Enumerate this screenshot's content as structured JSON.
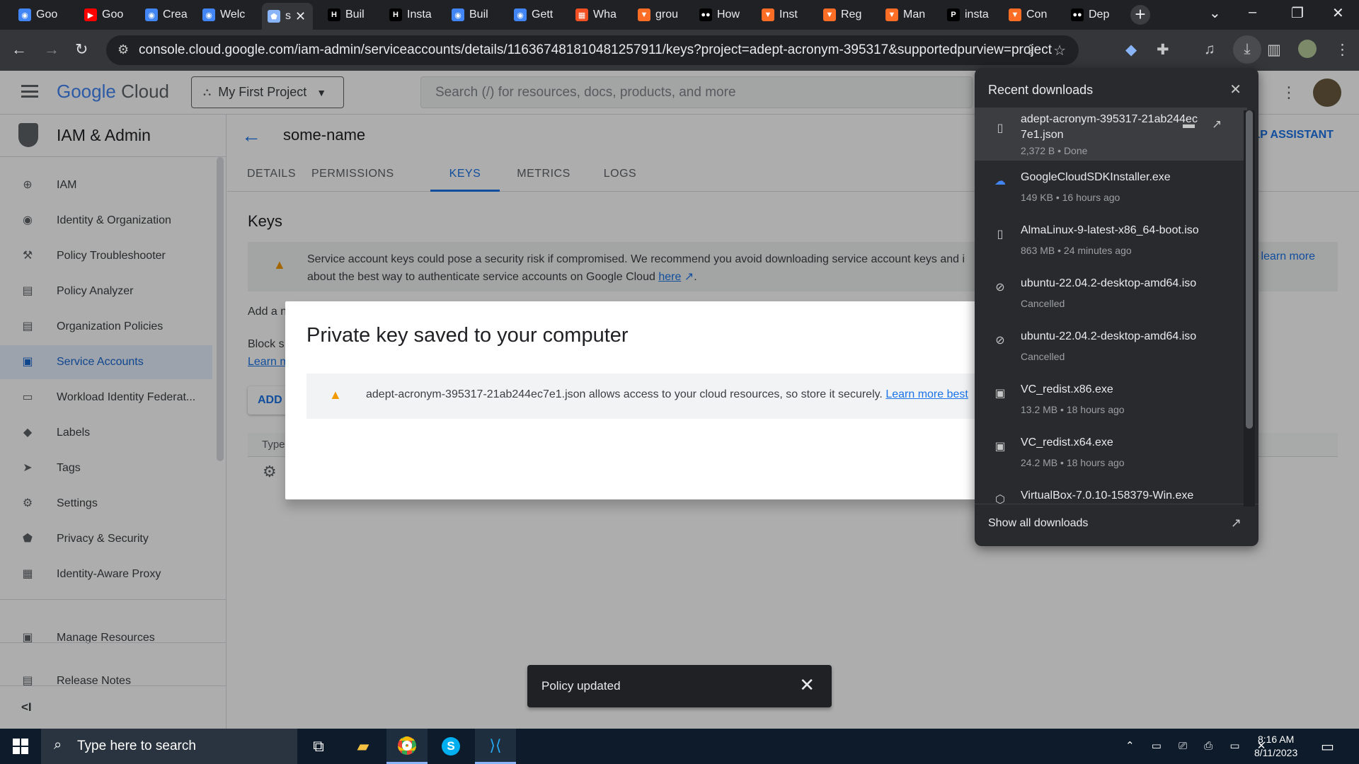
{
  "browser": {
    "tabs": [
      {
        "label": "Goo",
        "icon": "google-cloud-icon",
        "color": "#4285f4"
      },
      {
        "label": "Goo",
        "icon": "youtube-icon",
        "color": "#ff0000"
      },
      {
        "label": "Crea",
        "icon": "google-cloud-icon",
        "color": "#4285f4"
      },
      {
        "label": "Welc",
        "icon": "google-cloud-icon",
        "color": "#4285f4"
      },
      {
        "label": "s",
        "icon": "shield-icon",
        "color": "#8ab4f8"
      },
      {
        "label": "Buil",
        "icon": "hashicorp-icon",
        "color": "#000000"
      },
      {
        "label": "Insta",
        "icon": "hashicorp-icon",
        "color": "#000000"
      },
      {
        "label": "Buil",
        "icon": "google-cloud-icon",
        "color": "#4285f4"
      },
      {
        "label": "Gett",
        "icon": "google-cloud-icon",
        "color": "#4285f4"
      },
      {
        "label": "Wha",
        "icon": "microsoft-icon",
        "color": "#f25022"
      },
      {
        "label": "grou",
        "icon": "gitlab-icon",
        "color": "#fc6d26"
      },
      {
        "label": "How",
        "icon": "medium-icon",
        "color": "#000000"
      },
      {
        "label": "Inst",
        "icon": "gitlab-icon",
        "color": "#fc6d26"
      },
      {
        "label": "Reg",
        "icon": "gitlab-icon",
        "color": "#fc6d26"
      },
      {
        "label": "Man",
        "icon": "gitlab-icon",
        "color": "#fc6d26"
      },
      {
        "label": "insta",
        "icon": "p-icon",
        "color": "#000000"
      },
      {
        "label": "Con",
        "icon": "gitlab-icon",
        "color": "#fc6d26"
      },
      {
        "label": "Dep",
        "icon": "medium-icon",
        "color": "#000000"
      }
    ],
    "url": "console.cloud.google.com/iam-admin/serviceaccounts/details/116367481810481257911/keys?project=adept-acronym-395317&supportedpurview=project"
  },
  "header": {
    "logo_google": "Google",
    "logo_cloud": " Cloud",
    "project": "My First Project",
    "search_placeholder": "Search (/) for resources, docs, products, and more"
  },
  "sidebar": {
    "title": "IAM & Admin",
    "items": [
      {
        "label": "IAM",
        "icon": "add-person-icon"
      },
      {
        "label": "Identity & Organization",
        "icon": "account-circle-icon"
      },
      {
        "label": "Policy Troubleshooter",
        "icon": "wrench-icon"
      },
      {
        "label": "Policy Analyzer",
        "icon": "document-search-icon"
      },
      {
        "label": "Organization Policies",
        "icon": "list-document-icon"
      },
      {
        "label": "Service Accounts",
        "icon": "service-account-icon"
      },
      {
        "label": "Workload Identity Federat...",
        "icon": "id-card-icon"
      },
      {
        "label": "Labels",
        "icon": "label-icon"
      },
      {
        "label": "Tags",
        "icon": "tag-icon"
      },
      {
        "label": "Settings",
        "icon": "gear-icon"
      },
      {
        "label": "Privacy & Security",
        "icon": "shield-icon"
      },
      {
        "label": "Identity-Aware Proxy",
        "icon": "proxy-icon"
      }
    ],
    "manage_resources": "Manage Resources",
    "release_notes": "Release Notes"
  },
  "main": {
    "service_account_name": "some-name",
    "assistant": "LP ASSISTANT",
    "tabs": [
      "DETAILS",
      "PERMISSIONS",
      "KEYS",
      "METRICS",
      "LOGS"
    ],
    "active_tab": "KEYS",
    "section_title": "Keys",
    "warning_text": "Service account keys could pose a security risk if compromised. We recommend you avoid downloading service account keys and i",
    "warning_text2": "about the best way to authenticate service accounts on Google Cloud ",
    "warning_link": "here",
    "learn_more": "learn more",
    "add_text": "Add a n",
    "block_text": "Block s",
    "learn_text": "Learn m",
    "add_key": "ADD",
    "type_header": "Type"
  },
  "dialog": {
    "title": "Private key saved to your computer",
    "message": "adept-acronym-395317-21ab244ec7e1.json allows access to your cloud resources, so store it securely. ",
    "link": "Learn more best"
  },
  "snackbar": {
    "message": "Policy updated"
  },
  "downloads": {
    "title": "Recent downloads",
    "items": [
      {
        "name": "adept-acronym-395317-21ab244ec7e1.json",
        "status": "2,372 B • Done",
        "icon": "file-icon"
      },
      {
        "name": "GoogleCloudSDKInstaller.exe",
        "status": "149 KB • 16 hours ago",
        "icon": "google-cloud-icon"
      },
      {
        "name": "AlmaLinux-9-latest-x86_64-boot.iso",
        "status": "863 MB • 24 minutes ago",
        "icon": "file-icon"
      },
      {
        "name": "ubuntu-22.04.2-desktop-amd64.iso",
        "status": "Cancelled",
        "icon": "cancelled-icon"
      },
      {
        "name": "ubuntu-22.04.2-desktop-amd64.iso",
        "status": "Cancelled",
        "icon": "cancelled-icon"
      },
      {
        "name": "VC_redist.x86.exe",
        "status": "13.2 MB • 18 hours ago",
        "icon": "installer-icon"
      },
      {
        "name": "VC_redist.x64.exe",
        "status": "24.2 MB • 18 hours ago",
        "icon": "installer-icon"
      },
      {
        "name": "VirtualBox-7.0.10-158379-Win.exe",
        "status": "",
        "icon": "virtualbox-icon"
      }
    ],
    "show_all": "Show all downloads"
  },
  "taskbar": {
    "search_placeholder": "Type here to search",
    "time": "8:16 AM",
    "date": "8/11/2023"
  }
}
